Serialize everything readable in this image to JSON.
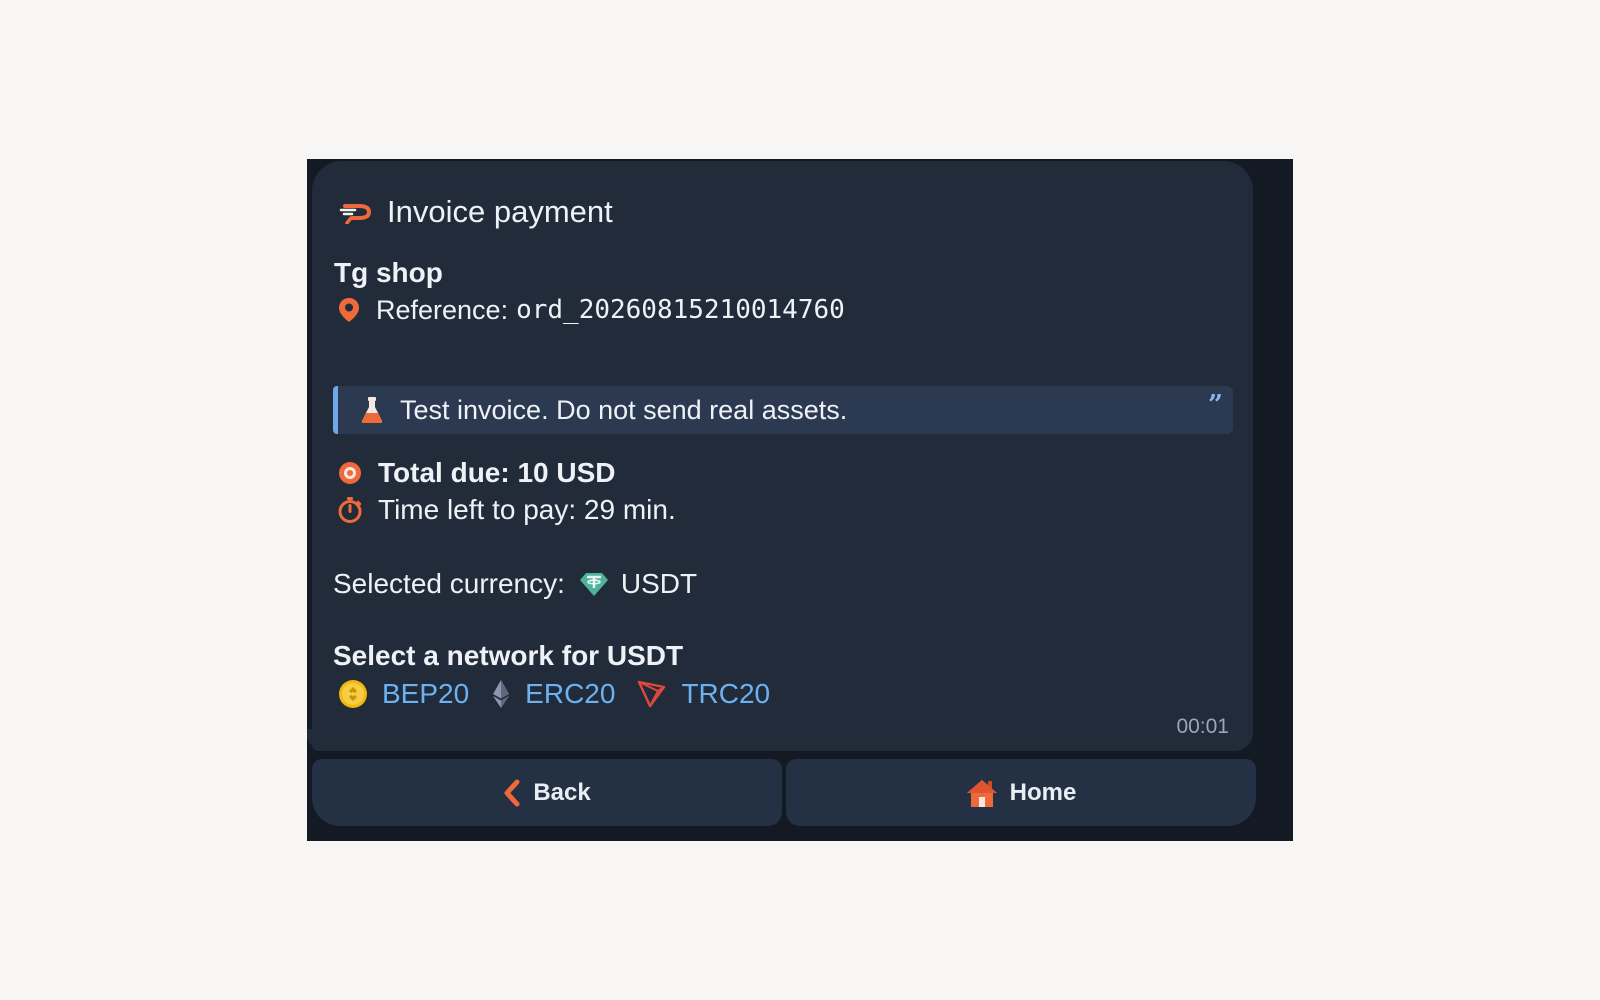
{
  "invoice": {
    "title": "Invoice payment",
    "shop_name": "Tg shop",
    "reference_label": "Reference:",
    "reference_code": "ord_20260815210014760",
    "notice": "Test invoice. Do not send real assets.",
    "total_due": "Total due: 10 USD",
    "time_left": "Time left to pay: 29 min.",
    "currency_label": "Selected currency:",
    "currency_value": "USDT",
    "network_title": "Select a network for USDT",
    "networks": [
      {
        "label": "BEP20",
        "icon": "bnb-coin-icon"
      },
      {
        "label": "ERC20",
        "icon": "ethereum-icon"
      },
      {
        "label": "TRC20",
        "icon": "tron-icon"
      }
    ],
    "timestamp": "00:01"
  },
  "buttons": {
    "back_label": "Back",
    "home_label": "Home"
  },
  "colors": {
    "background": "#f7f6f4",
    "chat_bg": "#141a23",
    "bubble": "#212b3a",
    "accent_orange": "#ef6a3a",
    "link_blue": "#6cb1f2",
    "quote_bar": "#6ea8e6"
  }
}
